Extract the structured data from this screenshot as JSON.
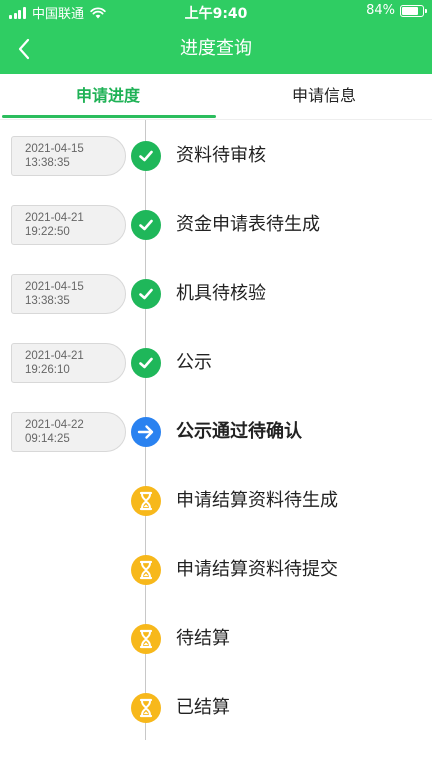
{
  "status_bar": {
    "carrier": "中国联通",
    "time": "上午9:40",
    "battery_text": "84%",
    "battery_level": 0.84
  },
  "nav": {
    "title": "进度查询"
  },
  "tabs": [
    {
      "label": "申请进度",
      "active": true
    },
    {
      "label": "申请信息",
      "active": false
    }
  ],
  "colors": {
    "brand_green": "#2fcd63",
    "done": "#1fb75a",
    "current": "#2a82f0",
    "pending": "#f7b81b"
  },
  "timeline": [
    {
      "status": "done",
      "icon": "check-icon",
      "date": "2021-04-15",
      "time": "13:38:35",
      "label": "资料待审核"
    },
    {
      "status": "done",
      "icon": "check-icon",
      "date": "2021-04-21",
      "time": "19:22:50",
      "label": "资金申请表待生成"
    },
    {
      "status": "done",
      "icon": "check-icon",
      "date": "2021-04-15",
      "time": "13:38:35",
      "label": "机具待核验"
    },
    {
      "status": "done",
      "icon": "check-icon",
      "date": "2021-04-21",
      "time": "19:26:10",
      "label": "公示"
    },
    {
      "status": "current",
      "icon": "arrow-right-icon",
      "date": "2021-04-22",
      "time": "09:14:25",
      "label": "公示通过待确认"
    },
    {
      "status": "pending",
      "icon": "hourglass-icon",
      "label": "申请结算资料待生成"
    },
    {
      "status": "pending",
      "icon": "hourglass-icon",
      "label": "申请结算资料待提交"
    },
    {
      "status": "pending",
      "icon": "hourglass-icon",
      "label": "待结算"
    },
    {
      "status": "pending",
      "icon": "hourglass-icon",
      "label": "已结算"
    }
  ]
}
